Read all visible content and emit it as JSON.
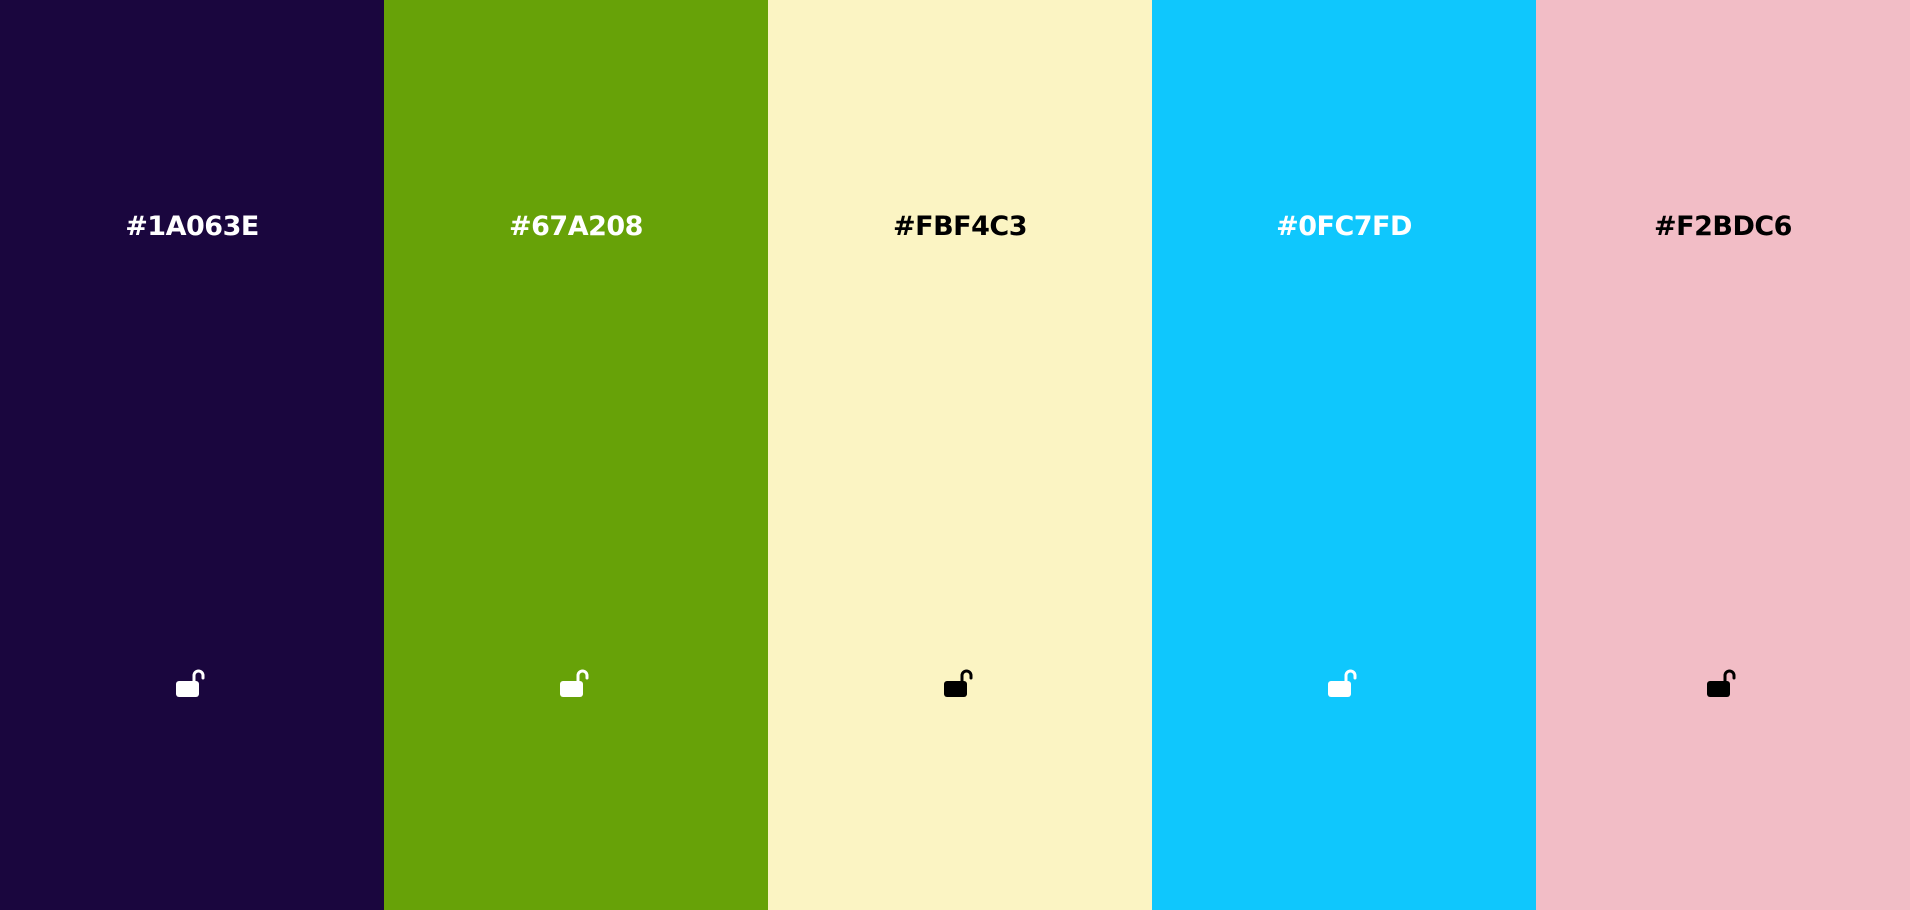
{
  "palette": {
    "colors": [
      {
        "hex": "#1A063E",
        "text_color": "#ffffff",
        "lock_icon": "unlocked-padlock-icon",
        "locked": false
      },
      {
        "hex": "#67A208",
        "text_color": "#ffffff",
        "lock_icon": "unlocked-padlock-icon",
        "locked": false
      },
      {
        "hex": "#FBF4C3",
        "text_color": "#000000",
        "lock_icon": "unlocked-padlock-icon",
        "locked": false
      },
      {
        "hex": "#0FC7FD",
        "text_color": "#ffffff",
        "lock_icon": "unlocked-padlock-icon",
        "locked": false
      },
      {
        "hex": "#F2BDC6",
        "text_color": "#000000",
        "lock_icon": "unlocked-padlock-icon",
        "locked": false
      }
    ]
  }
}
